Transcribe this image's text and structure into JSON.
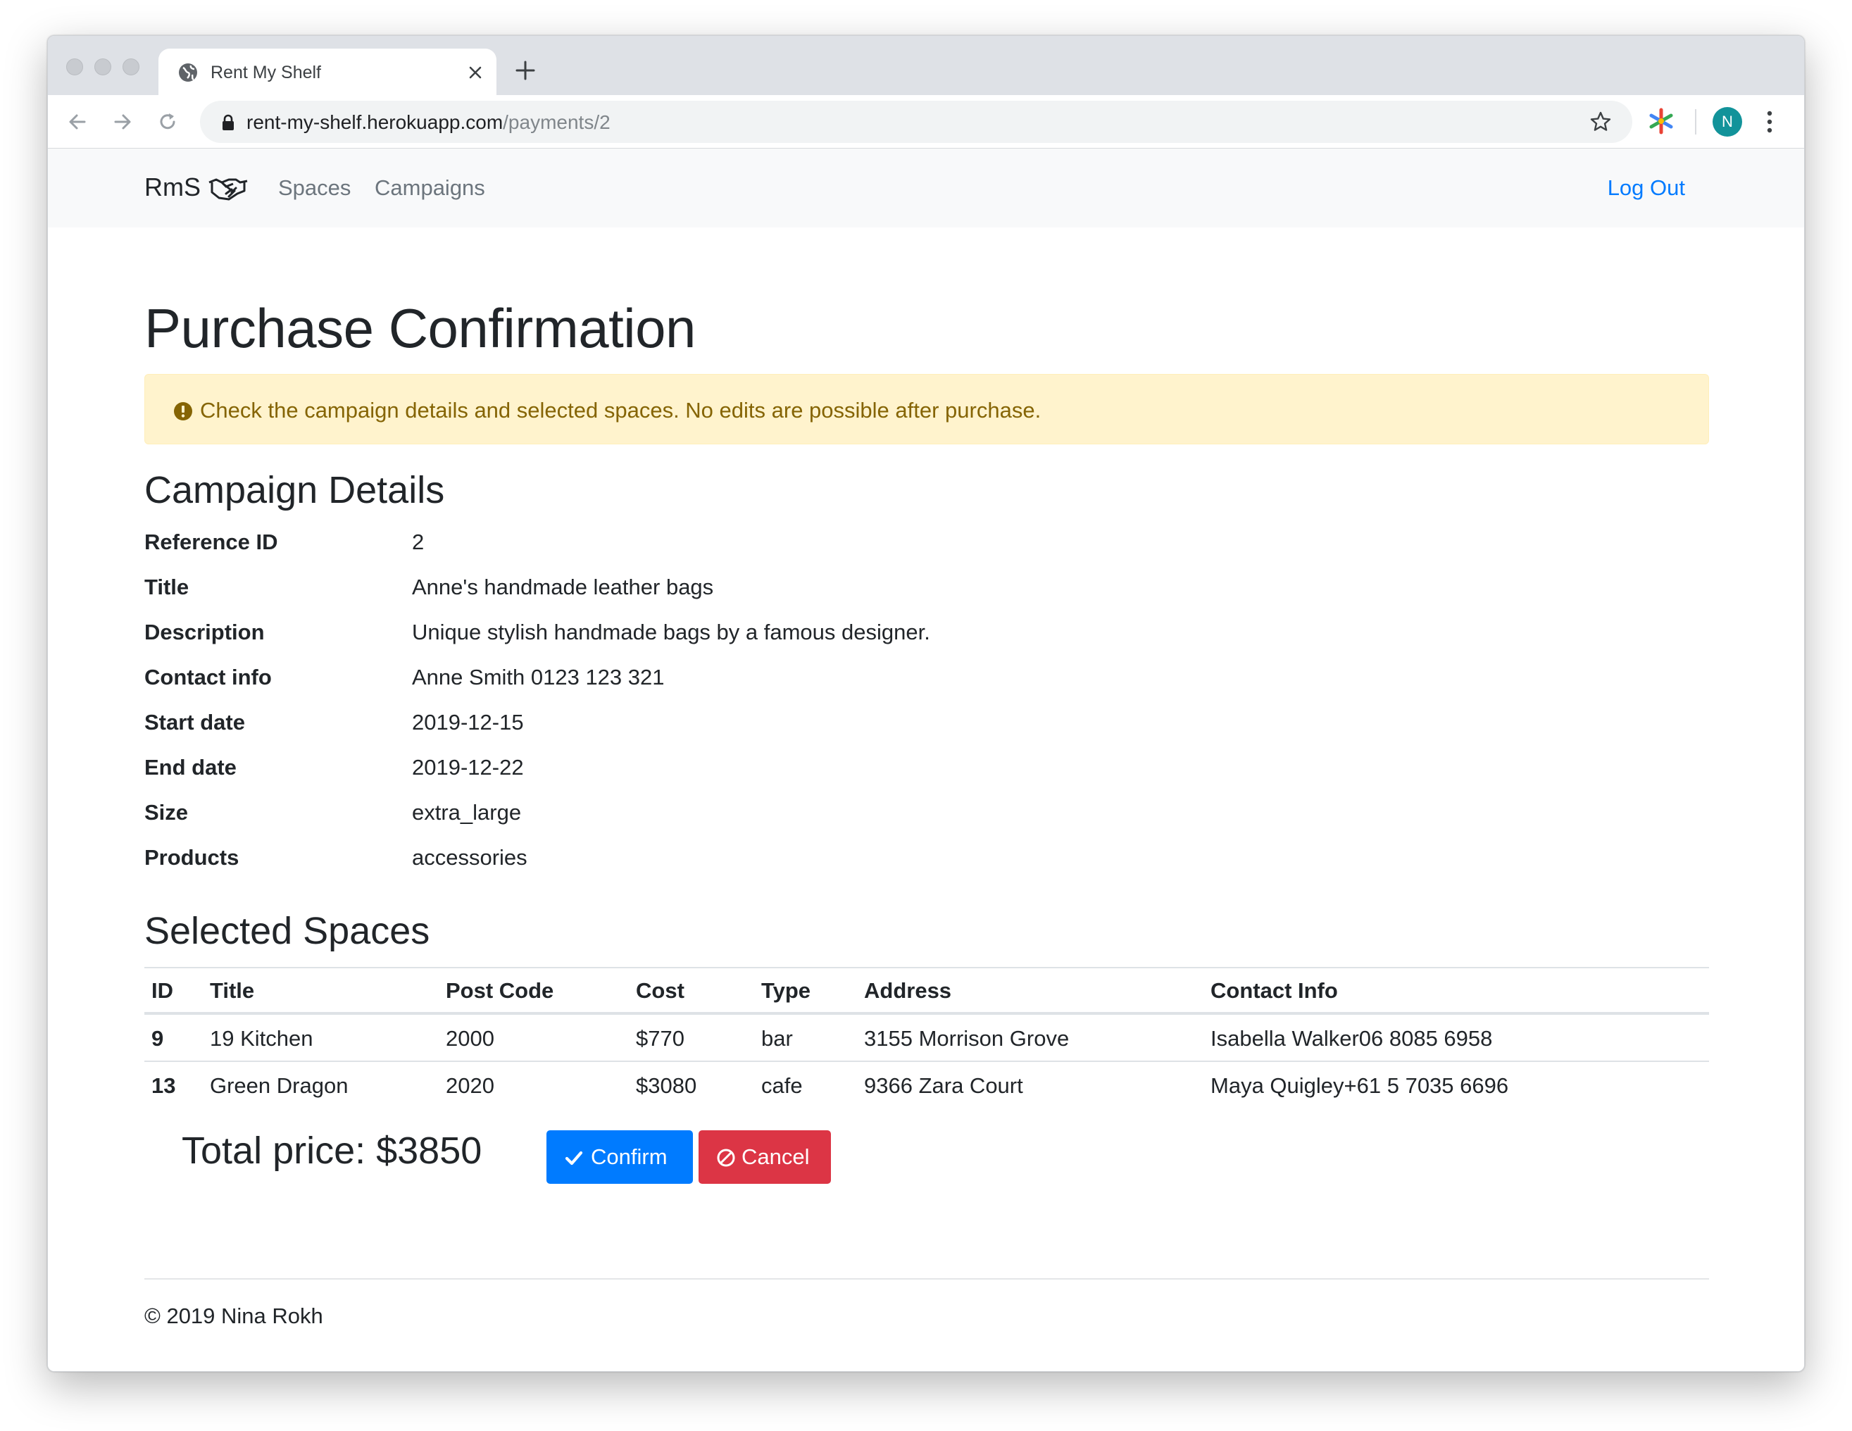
{
  "browser": {
    "tab_title": "Rent My Shelf",
    "url_host": "rent-my-shelf.herokuapp.com",
    "url_path": "/payments/2",
    "profile_initial": "N"
  },
  "navbar": {
    "brand": "RmS",
    "links": [
      "Spaces",
      "Campaigns"
    ],
    "logout": "Log Out"
  },
  "page": {
    "title": "Purchase Confirmation",
    "alert": "Check the campaign details and selected spaces. No edits are possible after purchase."
  },
  "campaign": {
    "heading": "Campaign Details",
    "fields": [
      {
        "label": "Reference ID",
        "value": "2"
      },
      {
        "label": "Title",
        "value": "Anne's handmade leather bags"
      },
      {
        "label": "Description",
        "value": "Unique stylish handmade bags by a famous designer."
      },
      {
        "label": "Contact info",
        "value": "Anne Smith 0123 123 321"
      },
      {
        "label": "Start date",
        "value": "2019-12-15"
      },
      {
        "label": "End date",
        "value": "2019-12-22"
      },
      {
        "label": "Size",
        "value": "extra_large"
      },
      {
        "label": "Products",
        "value": "accessories"
      }
    ]
  },
  "spaces": {
    "heading": "Selected Spaces",
    "columns": [
      "ID",
      "Title",
      "Post Code",
      "Cost",
      "Type",
      "Address",
      "Contact Info"
    ],
    "rows": [
      [
        "9",
        "19 Kitchen",
        "2000",
        "$770",
        "bar",
        "3155 Morrison Grove",
        "Isabella Walker06 8085 6958"
      ],
      [
        "13",
        "Green Dragon",
        "2020",
        "$3080",
        "cafe",
        "9366 Zara Court",
        "Maya Quigley+61 5 7035 6696"
      ]
    ]
  },
  "checkout": {
    "total": "Total price: $3850",
    "confirm": "Confirm",
    "cancel": "Cancel"
  },
  "footer": {
    "copyright": "© 2019 Nina Rokh"
  },
  "colors": {
    "primary": "#007bff",
    "danger": "#dc3545",
    "alert_bg": "#fff3cd",
    "alert_text": "#856404",
    "navbar_bg": "#f8f9fa"
  }
}
